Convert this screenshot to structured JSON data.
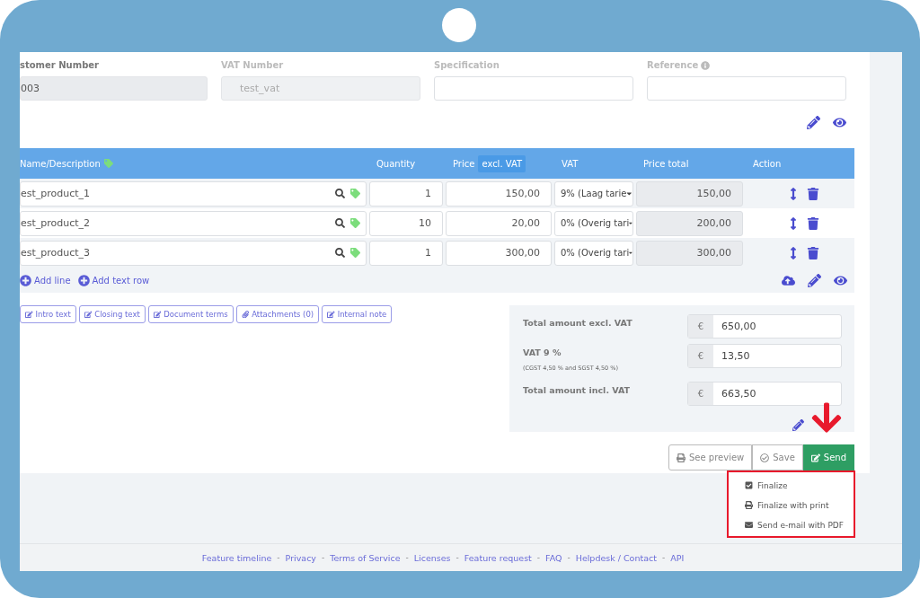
{
  "form_fields": [
    {
      "label": "stomer Number",
      "value": "003",
      "disabled": true,
      "info": false
    },
    {
      "label": "VAT Number",
      "placeholder": "test_vat",
      "disabled": true,
      "info": false
    },
    {
      "label": "Specification",
      "disabled": false,
      "info": false
    },
    {
      "label": "Reference",
      "disabled": false,
      "info": true
    }
  ],
  "table": {
    "columns": [
      {
        "label": "Name/Description",
        "tag": true
      },
      {
        "label": "Quantity"
      },
      {
        "label": "Price",
        "badge": "excl. VAT"
      },
      {
        "label": "VAT"
      },
      {
        "label": "Price total"
      },
      {
        "label": "Action"
      }
    ],
    "rows": [
      {
        "name": "est_product_1",
        "quantity": "1",
        "price": "150,00",
        "vat": "9% (Laag tarie",
        "total": "150,00"
      },
      {
        "name": "est_product_2",
        "quantity": "10",
        "price": "20,00",
        "vat": "0% (Overig tari",
        "total": "200,00"
      },
      {
        "name": "est_product_3",
        "quantity": "1",
        "price": "300,00",
        "vat": "0% (Overig tari",
        "total": "300,00"
      }
    ],
    "add_links": [
      "Add line",
      "Add text row"
    ]
  },
  "text_buttons": [
    {
      "label": "Intro text"
    },
    {
      "label": "Closing text"
    },
    {
      "label": "Document terms"
    },
    {
      "label": "Attachments (0)"
    },
    {
      "label": "Internal note"
    }
  ],
  "totals": [
    {
      "label": "Total amount excl. VAT",
      "currency": "€",
      "value": "650,00"
    },
    {
      "label": "VAT  9 %",
      "note": "(CGST 4,50 % and SGST 4,50 %)",
      "currency": "€",
      "value": "13,50"
    },
    {
      "label": "Total amount incl. VAT",
      "currency": "€",
      "value": "663,50"
    }
  ],
  "actions": [
    {
      "label": "See preview",
      "kind": "outline"
    },
    {
      "label": "Save",
      "kind": "outline"
    },
    {
      "label": "Send",
      "kind": "primary"
    }
  ],
  "send_menu": {
    "highlighted": true,
    "items": [
      {
        "label": "Finalize"
      },
      {
        "label": "Finalize with print"
      },
      {
        "label": "Send e-mail with PDF"
      }
    ]
  },
  "footer_separator": "-",
  "footer_links": [
    "Feature timeline",
    "Privacy",
    "Terms of Service",
    "Licenses",
    "Feature request",
    "FAQ",
    "Helpdesk / Contact",
    "API"
  ]
}
